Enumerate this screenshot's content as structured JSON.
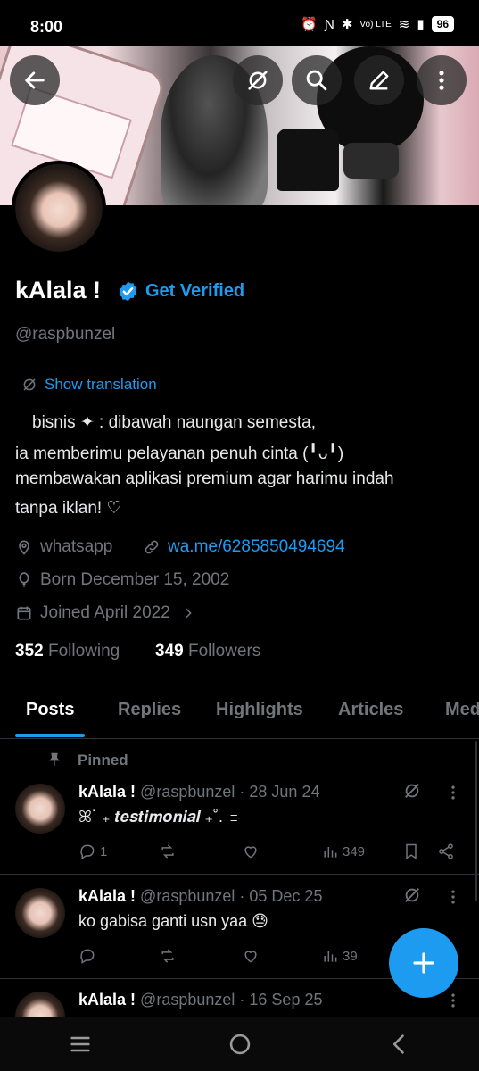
{
  "status_bar": {
    "time": "8:00",
    "battery": "96",
    "network": "Vo) LTE"
  },
  "profile": {
    "name": "kAlala !",
    "get_verified": "Get Verified",
    "handle": "@raspbunzel",
    "show_translation": "Show translation",
    "bio": [
      "　bisnis ✦ :  dibawah naungan semesta,",
      "ia memberimu pelayanan penuh cinta (╹ᴗ╹)",
      "membawakan aplikasi premium agar harimu indah",
      "tanpa iklan! ♡"
    ],
    "location": "whatsapp",
    "website": "wa.me/6285850494694",
    "born": "Born December 15, 2002",
    "joined": "Joined April 2022",
    "following_count": "352",
    "following_label": "Following",
    "followers_count": "349",
    "followers_label": "Followers"
  },
  "tabs": [
    {
      "label": "Posts",
      "active": true
    },
    {
      "label": "Replies"
    },
    {
      "label": "Highlights"
    },
    {
      "label": "Articles"
    },
    {
      "label": "Med"
    }
  ],
  "posts": [
    {
      "pinned_label": "Pinned",
      "name": "kAlala !",
      "handle": "@raspbunzel",
      "date": "· 28 Jun 24",
      "text": "ꕤ˙ ₊ 𝒕𝒆𝒔𝒕𝒊𝒎𝒐𝒏𝒊𝒂𝒍 ₊˚. ⌯",
      "replies": "1",
      "views": "349"
    },
    {
      "name": "kAlala !",
      "handle": "@raspbunzel",
      "date": "· 05 Dec 25",
      "text": "ko gabisa ganti usn yaa 😓",
      "views": "39"
    },
    {
      "name": "kAlala !",
      "handle": "@raspbunzel",
      "date": "· 16 Sep 25"
    }
  ],
  "colors": {
    "accent": "#1d9bf0",
    "background": "#000000",
    "muted": "#71767b"
  }
}
